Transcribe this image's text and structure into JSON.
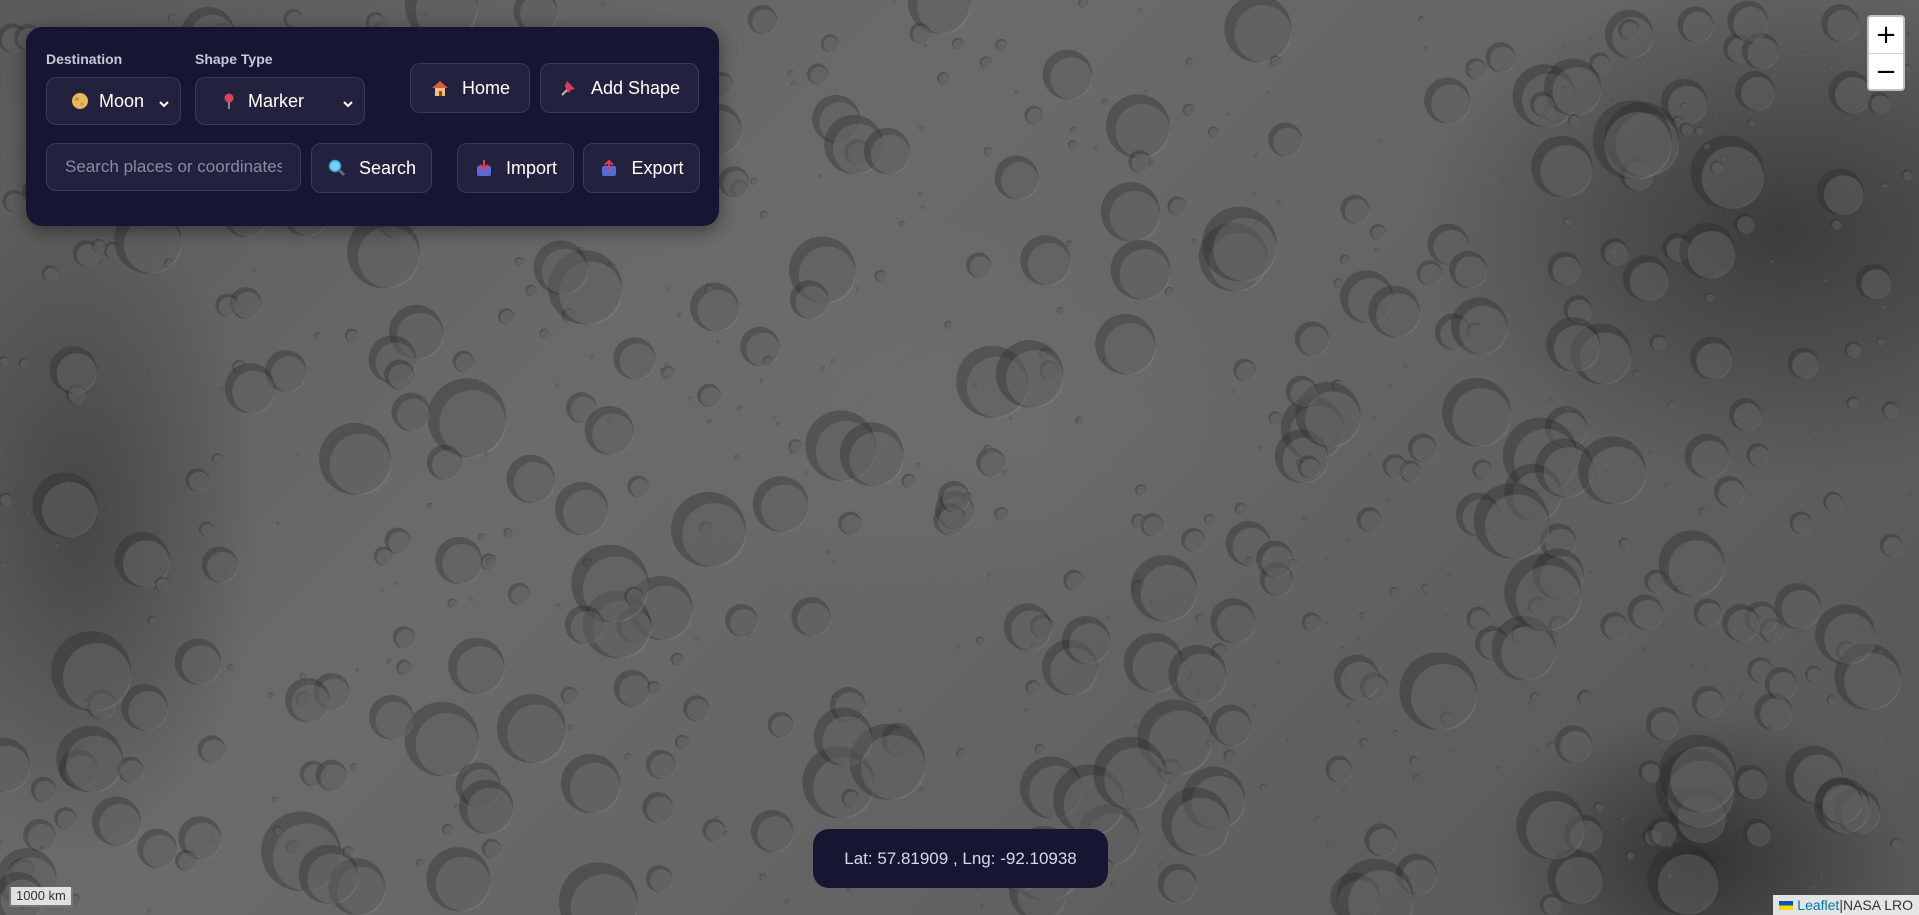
{
  "map": {
    "layer": "NASA LRO Moon imagery",
    "background_color": "#5f5f5f"
  },
  "controls": {
    "destination_label": "Destination",
    "destination_value": "Moon",
    "destination_icon": "moon-icon",
    "shape_type_label": "Shape Type",
    "shape_type_value": "Marker",
    "shape_type_icon": "pin-icon",
    "home_label": "Home",
    "home_icon": "house-icon",
    "add_shape_label": "Add Shape",
    "add_shape_icon": "pushpin-icon",
    "search_placeholder": "Search places or coordinates",
    "search_value": "",
    "search_label": "Search",
    "search_icon": "magnifier-icon",
    "import_label": "Import",
    "import_icon": "inbox-in-icon",
    "export_label": "Export",
    "export_icon": "inbox-out-icon",
    "panel_color": "#161632",
    "button_color": "#22223e"
  },
  "zoom": {
    "in_label": "+",
    "out_label": "−"
  },
  "coordinates": {
    "text": "Lat: 57.81909 , Lng: -92.10938"
  },
  "scale": {
    "text": "1000 km"
  },
  "attribution": {
    "leaflet": "Leaflet",
    "separator": " | ",
    "source": "NASA LRO"
  }
}
